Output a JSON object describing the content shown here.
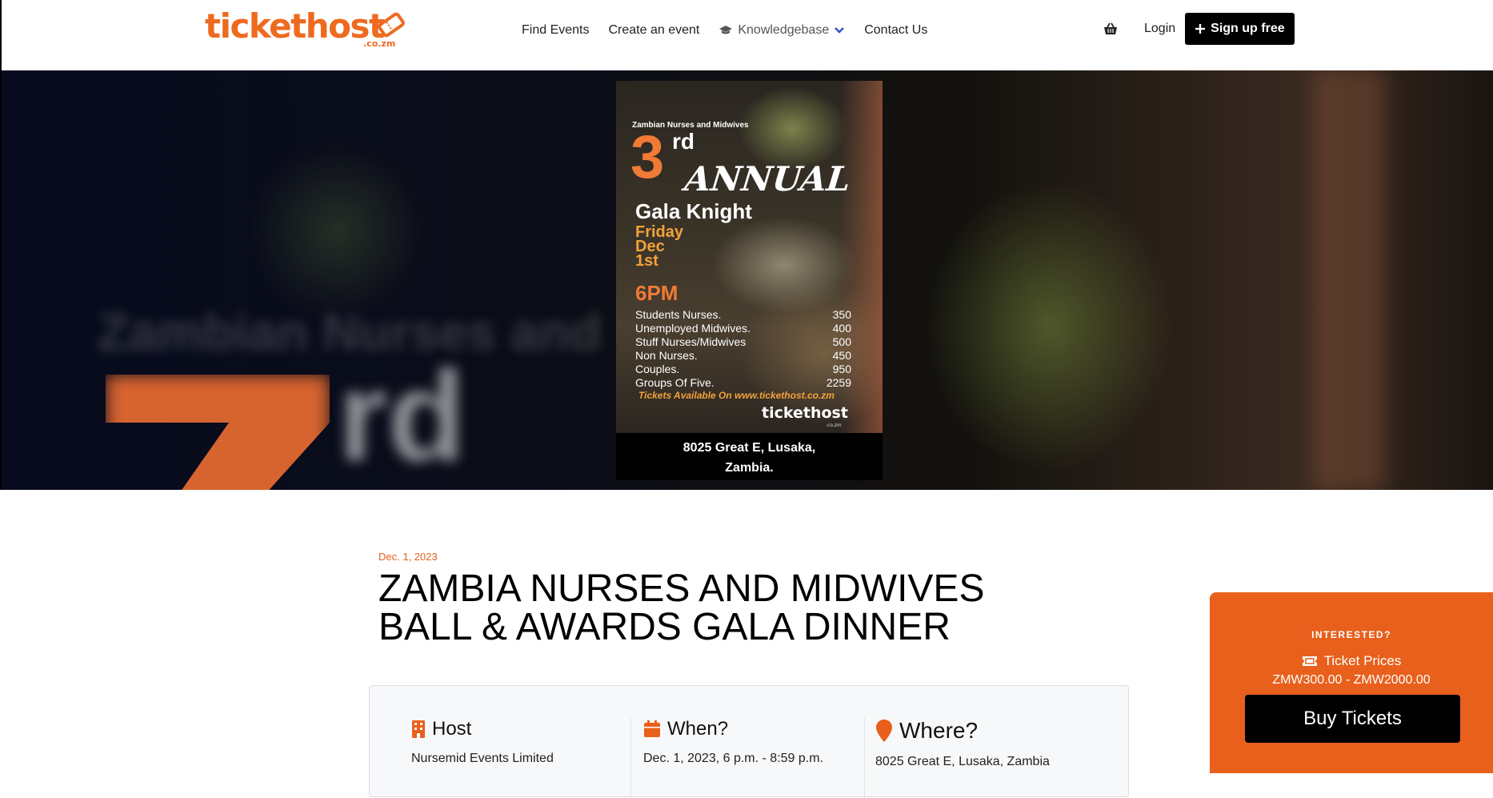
{
  "brand": {
    "logo_text": "tickethost",
    "logo_tld": ".co.zm",
    "accent": "#ee6a1f"
  },
  "nav": {
    "links": [
      "Find Events",
      "Create an event",
      "Knowledgebase",
      "Contact Us"
    ],
    "knowledgebase_icon": "graduation-cap-icon",
    "cart_icon": "basket-icon",
    "login": "Login",
    "signup": "Sign up free"
  },
  "hero": {
    "bg_text_line": "Zambian Nurses and",
    "bg_text_rd": "rd"
  },
  "poster": {
    "org": "Zambian Nurses and  Midwives",
    "num": "3",
    "sup": "rd",
    "annual": "ANNUAL",
    "gala": "Gala Knight",
    "day": "Friday",
    "month": "Dec",
    "date": "1st",
    "time": "6PM",
    "prices": [
      {
        "label": "Students Nurses.",
        "value": "350"
      },
      {
        "label": "Unemployed Midwives.",
        "value": "400"
      },
      {
        "label": "Stuff Nurses/Midwives",
        "value": "500"
      },
      {
        "label": "Non Nurses.",
        "value": "450"
      },
      {
        "label": "Couples.",
        "value": "950"
      },
      {
        "label": "Groups Of Five.",
        "value": "2259"
      }
    ],
    "available": "Tickets Available On www.tickethost.co.zm",
    "brand": "tickethost",
    "brand_tld": ".co.zm",
    "address_line1": "8025 Great E, Lusaka,",
    "address_line2": "Zambia."
  },
  "event": {
    "date": "Dec. 1, 2023",
    "title": "ZAMBIA NURSES AND MIDWIVES BALL & AWARDS GALA DINNER",
    "host_label": "Host",
    "host_value": "Nursemid Events Limited",
    "when_label": "When?",
    "when_value": "Dec. 1, 2023, 6 p.m. - 8:59 p.m.",
    "where_label": "Where?",
    "where_value": "8025 Great E, Lusaka, Zambia"
  },
  "side": {
    "kicker": "INTERESTED?",
    "prices_label": "Ticket Prices",
    "prices": "ZMW300.00 - ZMW2000.00",
    "buy": "Buy Tickets",
    "accent": "#e8601c"
  }
}
